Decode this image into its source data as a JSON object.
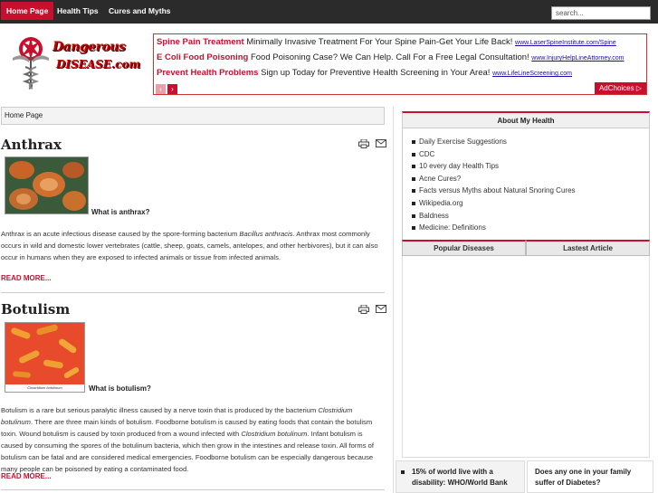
{
  "nav": {
    "tabs": [
      {
        "label": "Home Page"
      },
      {
        "label": "Health Tips"
      },
      {
        "label": "Cures and Myths"
      }
    ],
    "search_placeholder": "search..."
  },
  "logo": {
    "line1": "Dangerous",
    "line2": "DISEASE.com"
  },
  "ads": {
    "items": [
      {
        "headline": "Spine Pain Treatment",
        "text": "Minimally Invasive Treatment For Your Spine Pain-Get Your Life Back!",
        "url": "www.LaserSpineInstitute.com/Spine"
      },
      {
        "headline": "E Coli Food Poisoning",
        "text": "Food Poisoning Case? We Can Help. Call For a Free Legal Consultation!",
        "url": "www.InjuryHelpLineAttorney.com"
      },
      {
        "headline": "Prevent Health Problems",
        "text": "Sign up Today for Preventive Health Screening in Your Area!",
        "url": "www.LifeLineScreening.com"
      }
    ],
    "prev": "‹",
    "next": "›",
    "adchoices": "AdChoices ▷"
  },
  "breadcrumb": "Home Page",
  "articles": [
    {
      "title": "Anthrax",
      "question": "What is anthrax?",
      "body_prefix": "Anthrax is an acute infectious disease caused by the spore-forming bacterium ",
      "body_italic": "Bacillus anthracis",
      "body_suffix": ". Anthrax most commonly occurs in wild and domestic lower vertebrates (cattle, sheep, goats, camels, antelopes, and other herbivores), but it can also occur in humans when they are exposed to infected animals or tissue from infected animals.",
      "read_more": "READ MORE..."
    },
    {
      "title": "Botulism",
      "question": "What is botulism?",
      "thumb_caption": "Clostridium botulinum",
      "body_prefix": "Botulism is a rare but serious paralytic illness caused by a nerve toxin that is produced by the bacterium ",
      "body_italic": "Clostridium botulinum",
      "body_mid": ". There are three main kinds of botulism. Foodborne botulism is caused by eating foods that contain the botulism toxin. Wound botulism is caused by toxin produced from a wound infected with ",
      "body_italic2": "Clostridium botulinum",
      "body_suffix": ". Infant botulism is caused by consuming the spores of the botulinum bacteria, which then grow in the intestines and release toxin. All forms of botulism can be fatal and are considered medical emergencies. Foodborne botulism can be especially dangerous because many people can be poisoned by eating a contaminated food.",
      "read_more": "READ MORE..."
    }
  ],
  "sidebar": {
    "about_title": "About My Health",
    "about_links": [
      "Daily Exercise Suggestions",
      "CDC",
      "10 every day Health Tips",
      "Acne Cures?",
      "Facts versus Myths about Natural Snoring Cures",
      "Wikipedia.org",
      "Baldness",
      "Medicine: Definitions"
    ],
    "tab_popular": "Popular Diseases",
    "tab_latest": "Lastest Article",
    "bottom_left": "15% of world live with a disability: WHO/World Bank",
    "bottom_right": "Does any one in your family suffer of Diabetes?"
  },
  "colors": {
    "accent": "#c8102e",
    "nav_bg": "#2b2b2b",
    "link": "#1a0dab"
  }
}
